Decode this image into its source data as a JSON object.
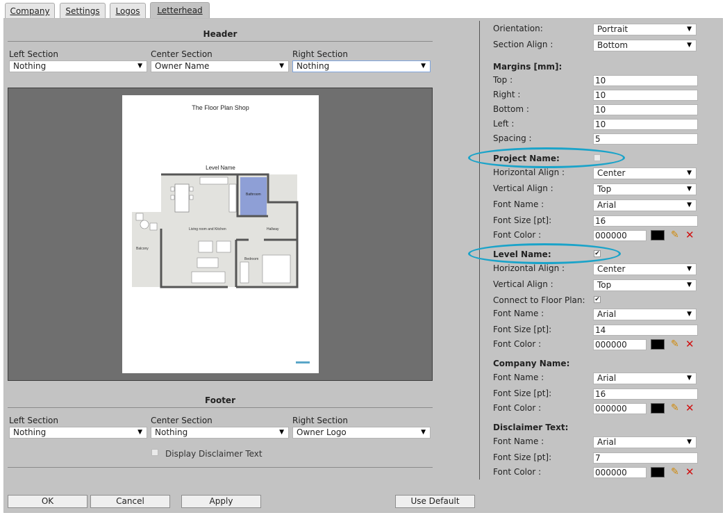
{
  "tabs": [
    {
      "label": "Company"
    },
    {
      "label": "Settings"
    },
    {
      "label": "Logos"
    },
    {
      "label": "Letterhead"
    }
  ],
  "header": {
    "title": "Header",
    "left_label": "Left Section",
    "left_value": "Nothing",
    "center_label": "Center Section",
    "center_value": "Owner Name",
    "right_label": "Right Section",
    "right_value": "Nothing"
  },
  "preview": {
    "company_title": "The Floor Plan Shop",
    "level_title": "Level Name",
    "rooms": {
      "living": "Living room and Kitchen",
      "bathroom": "Bathroom",
      "hallway": "Hallway",
      "balcony": "Balcony",
      "bedroom": "Bedroom"
    }
  },
  "footer": {
    "title": "Footer",
    "left_label": "Left Section",
    "left_value": "Nothing",
    "center_label": "Center Section",
    "center_value": "Nothing",
    "right_label": "Right Section",
    "right_value": "Owner Logo",
    "disclaimer_label": "Display Disclaimer Text"
  },
  "page_settings": {
    "orientation_label": "Orientation:",
    "orientation_value": "Portrait",
    "section_align_label": "Section Align :",
    "section_align_value": "Bottom"
  },
  "margins": {
    "title": "Margins [mm]:",
    "top_label": "Top :",
    "top_value": "10",
    "right_label": "Right :",
    "right_value": "10",
    "bottom_label": "Bottom :",
    "bottom_value": "10",
    "left_label": "Left :",
    "left_value": "10",
    "spacing_label": "Spacing :",
    "spacing_value": "5"
  },
  "project_name": {
    "title": "Project Name:",
    "checked": false,
    "halign_label": "Horizontal Align :",
    "halign_value": "Center",
    "valign_label": "Vertical Align :",
    "valign_value": "Top",
    "font_label": "Font Name :",
    "font_value": "Arial",
    "size_label": "Font Size [pt]:",
    "size_value": "16",
    "color_label": "Font Color :",
    "color_value": "000000"
  },
  "level_name": {
    "title": "Level Name:",
    "checked": true,
    "check_mark": "✔",
    "halign_label": "Horizontal Align :",
    "halign_value": "Center",
    "valign_label": "Vertical Align :",
    "valign_value": "Top",
    "connect_label": "Connect to Floor Plan:",
    "connect_checked": true,
    "connect_mark": "✔",
    "font_label": "Font Name :",
    "font_value": "Arial",
    "size_label": "Font Size [pt]:",
    "size_value": "14",
    "color_label": "Font Color :",
    "color_value": "000000"
  },
  "company_name": {
    "title": "Company Name:",
    "font_label": "Font Name :",
    "font_value": "Arial",
    "size_label": "Font Size [pt]:",
    "size_value": "16",
    "color_label": "Font Color :",
    "color_value": "000000"
  },
  "disclaimer": {
    "title": "Disclaimer Text:",
    "font_label": "Font Name :",
    "font_value": "Arial",
    "size_label": "Font Size [pt]:",
    "size_value": "7",
    "color_label": "Font Color :",
    "color_value": "000000"
  },
  "buttons": {
    "ok": "OK",
    "cancel": "Cancel",
    "apply": "Apply",
    "use_default": "Use Default"
  },
  "colors": {
    "panel_bg": "#c3c3c3",
    "highlight_oval": "#1aa3c9",
    "swatch": "#000000",
    "preview_bg": "#6f6f6f"
  },
  "icons": {
    "edit": "pencil-icon",
    "clear": "close-icon",
    "dropdown": "chevron-down-icon"
  }
}
